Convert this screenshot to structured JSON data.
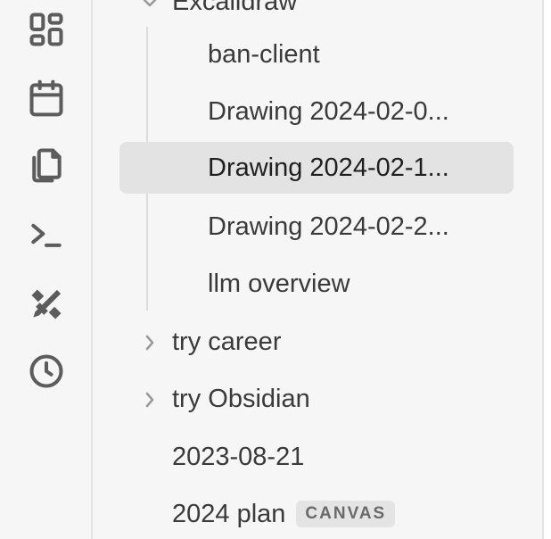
{
  "ribbon": {
    "items": [
      {
        "icon": "dashboard-icon"
      },
      {
        "icon": "calendar-icon"
      },
      {
        "icon": "copy-icon"
      },
      {
        "icon": "terminal-icon"
      },
      {
        "icon": "excalidraw-icon"
      },
      {
        "icon": "clock-icon"
      }
    ]
  },
  "tree": {
    "parent_folder": "Excalidraw",
    "children": [
      {
        "label": "ban-client",
        "active": false
      },
      {
        "label": "Drawing 2024-02-0...",
        "active": false
      },
      {
        "label": "Drawing 2024-02-1...",
        "active": true
      },
      {
        "label": "Drawing 2024-02-2...",
        "active": false
      },
      {
        "label": "llm overview",
        "active": false
      }
    ],
    "folders": [
      {
        "label": "try career",
        "icon": "chevron-right-icon"
      },
      {
        "label": "try Obsidian",
        "icon": "chevron-right-icon"
      }
    ],
    "files": [
      {
        "label": "2023-08-21"
      },
      {
        "label": "2024 plan",
        "badge": "CANVAS"
      }
    ]
  }
}
